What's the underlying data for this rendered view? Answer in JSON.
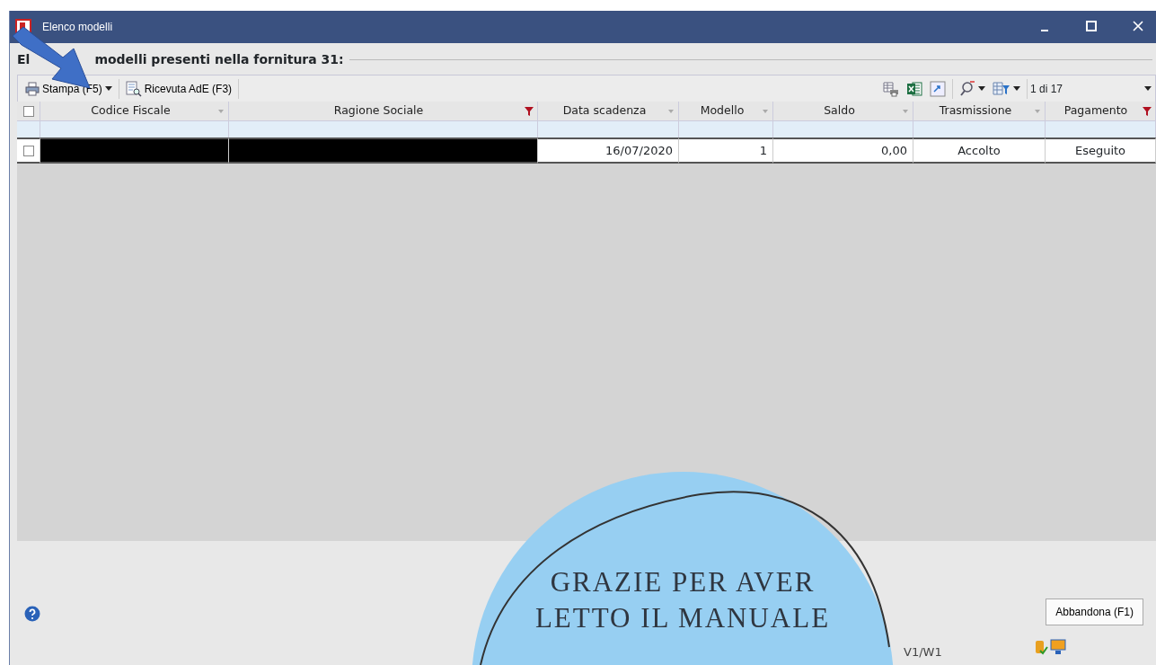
{
  "window": {
    "title": "Elenco modelli"
  },
  "group": {
    "title_start": "El",
    "title_rest": "modelli presenti nella fornitura 31:"
  },
  "toolbar": {
    "buttons": [
      {
        "label": "Stampa (F5)",
        "dropdown": true
      },
      {
        "label": "Ricevuta AdE (F3)",
        "dropdown": false
      }
    ],
    "right_icons": [
      {
        "dropdown": false
      },
      {
        "dropdown": false
      },
      {
        "dropdown": false
      },
      {
        "dropdown": true
      },
      {
        "dropdown": true
      }
    ],
    "pager": "1 di 17"
  },
  "table": {
    "select_all_checked": false,
    "columns": [
      {
        "label": "Codice Fiscale",
        "filtered": false
      },
      {
        "label": "Ragione Sociale",
        "filtered": true
      },
      {
        "label": "Data scadenza",
        "filtered": false
      },
      {
        "label": "Modello",
        "filtered": false
      },
      {
        "label": "Saldo",
        "filtered": false
      },
      {
        "label": "Trasmissione",
        "filtered": false
      },
      {
        "label": "Pagamento",
        "filtered": true
      }
    ],
    "rows": [
      {
        "checked": false,
        "cells": [
          {
            "kind": "redacted"
          },
          {
            "kind": "redacted"
          },
          {
            "kind": "text",
            "text": "16/07/2020"
          },
          {
            "kind": "text",
            "text": "1"
          },
          {
            "kind": "text",
            "text": "0,00"
          },
          {
            "kind": "text",
            "text": "Accolto"
          },
          {
            "kind": "text",
            "text": "Eseguito"
          }
        ]
      }
    ]
  },
  "footer": {
    "close_button": "Abbandona (F1)",
    "version": "V1/W1"
  },
  "overlay": {
    "lines": [
      "GRAZIE PER AVER",
      "LETTO IL MANUALE"
    ]
  }
}
